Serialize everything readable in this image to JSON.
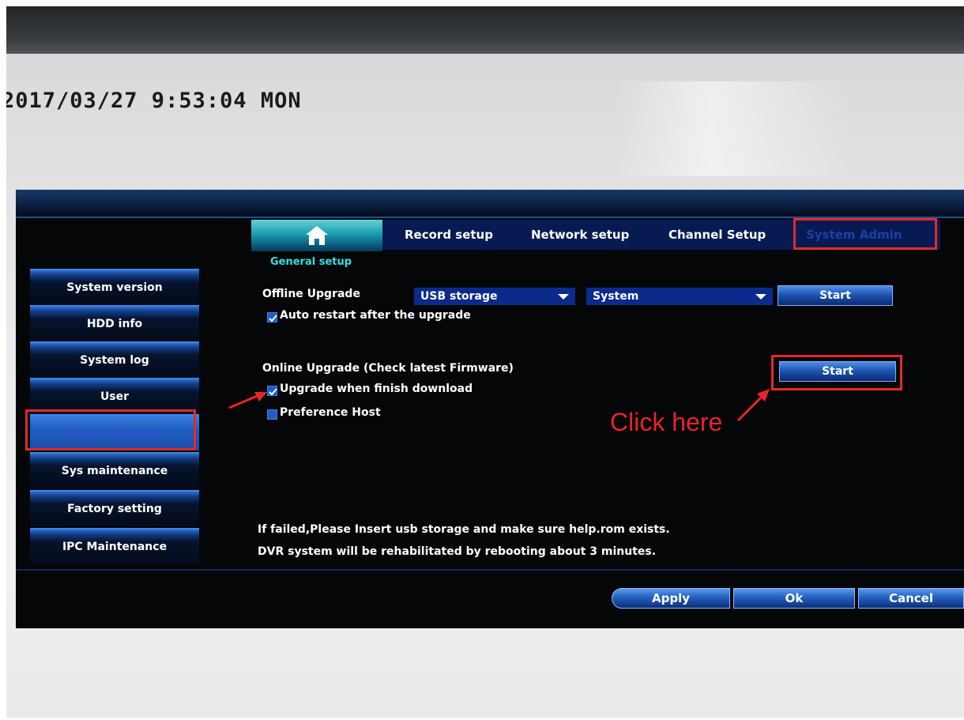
{
  "overlay": {
    "timestamp": "2017/03/27 9:53:04 MON",
    "click_here": "Click here"
  },
  "menu": {
    "home_icon": "home-icon",
    "tabs": [
      "Record setup",
      "Network setup",
      "Channel Setup",
      "System Admin"
    ],
    "subtitle": "General setup"
  },
  "sidebar": {
    "items": [
      "System version",
      "HDD info",
      "System log",
      "User",
      "System upgrade",
      "Sys maintenance",
      "Factory setting",
      "IPC Maintenance"
    ],
    "active_index": 4
  },
  "offline": {
    "label": "Offline Upgrade",
    "device": "USB storage",
    "target": "System",
    "start": "Start",
    "auto_restart": "Auto restart after the upgrade",
    "auto_restart_checked": true
  },
  "online": {
    "label": "Online Upgrade (Check latest Firmware)",
    "start": "Start",
    "upgrade_when_finish": "Upgrade when finish download",
    "upgrade_when_finish_checked": true,
    "preference_host": "Preference Host",
    "preference_host_checked": false
  },
  "notes": {
    "line1": "If failed,Please Insert usb storage and make sure help.rom exists.",
    "line2": "DVR system will be rehabilitated by rebooting about 3 minutes."
  },
  "footer": {
    "apply": "Apply",
    "ok": "Ok",
    "cancel": "Cancel"
  },
  "colors": {
    "highlight_red": "#e22a2a",
    "menu_blue": "#071a52",
    "accent_cyan": "#2ee0e0"
  }
}
